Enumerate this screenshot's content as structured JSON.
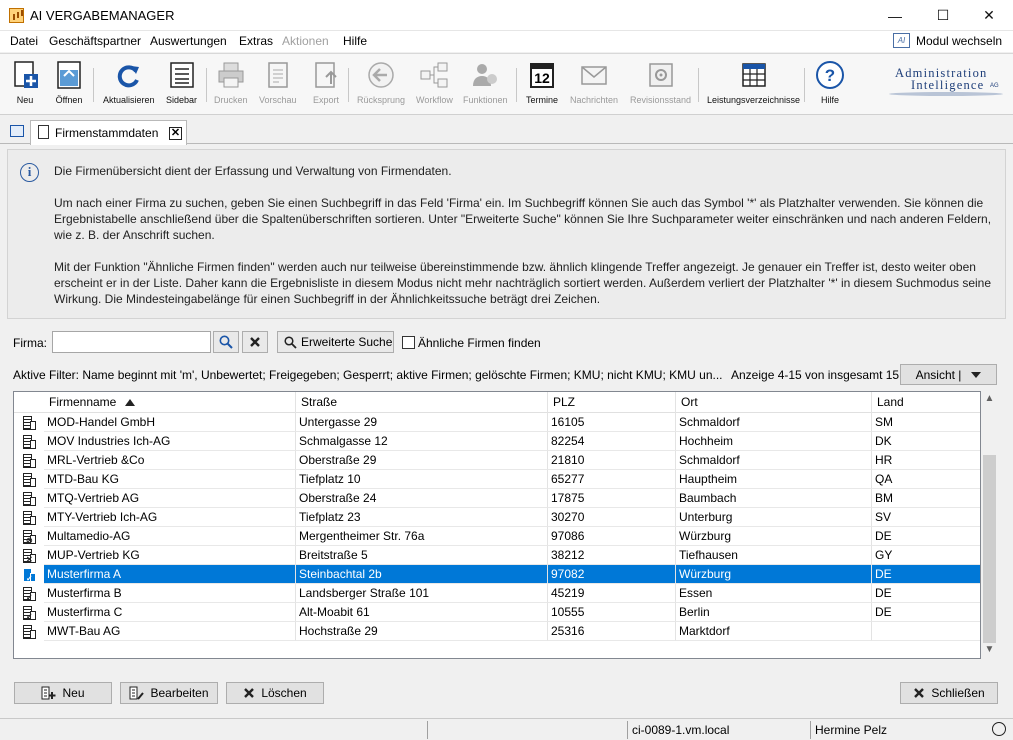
{
  "window": {
    "title": "AI VERGABEMANAGER",
    "minimize": "—",
    "maximize": "☐",
    "close": "✕"
  },
  "menu": {
    "items": [
      {
        "label": "Datei",
        "disabled": false
      },
      {
        "label": "Geschäftspartner",
        "disabled": false
      },
      {
        "label": "Auswertungen",
        "disabled": false
      },
      {
        "label": "Extras",
        "disabled": false
      },
      {
        "label": "Aktionen",
        "disabled": true
      },
      {
        "label": "Hilfe",
        "disabled": false
      }
    ],
    "modul_wechseln": "Modul wechseln",
    "modul_icon_text": "AI"
  },
  "toolbar": {
    "buttons": [
      {
        "label": "Neu",
        "icon": "new-document-icon",
        "disabled": false
      },
      {
        "label": "Öffnen",
        "icon": "open-icon",
        "disabled": false
      },
      {
        "label": "Aktualisieren",
        "icon": "refresh-icon",
        "disabled": false
      },
      {
        "label": "Sidebar",
        "icon": "sidebar-icon",
        "disabled": false
      },
      {
        "label": "Drucken",
        "icon": "print-icon",
        "disabled": true
      },
      {
        "label": "Vorschau",
        "icon": "preview-icon",
        "disabled": true
      },
      {
        "label": "Export",
        "icon": "export-icon",
        "disabled": true
      },
      {
        "label": "Rücksprung",
        "icon": "back-icon",
        "disabled": true
      },
      {
        "label": "Workflow",
        "icon": "workflow-icon",
        "disabled": true
      },
      {
        "label": "Funktionen",
        "icon": "functions-icon",
        "disabled": true
      },
      {
        "label": "Termine",
        "icon": "calendar-icon",
        "disabled": false
      },
      {
        "label": "Nachrichten",
        "icon": "mail-icon",
        "disabled": true
      },
      {
        "label": "Revisionsstand",
        "icon": "safe-icon",
        "disabled": true
      },
      {
        "label": "Leistungsverzeichnisse",
        "icon": "table-icon",
        "disabled": false
      },
      {
        "label": "Hilfe",
        "icon": "help-icon",
        "disabled": false
      }
    ],
    "calendar_day": "12",
    "brand_line1": "Administration",
    "brand_line2": "Intelligence",
    "brand_suffix": "AG"
  },
  "tab": {
    "label": "Firmenstammdaten",
    "close": "✕"
  },
  "info": {
    "p1": "Die Firmenübersicht dient der Erfassung und Verwaltung von Firmendaten.",
    "p2": "Um nach einer Firma zu suchen, geben Sie einen Suchbegriff in das Feld 'Firma' ein. Im Suchbegriff können Sie auch das Symbol '*' als Platzhalter verwenden. Sie können die Ergebnistabelle anschließend über die Spaltenüberschriften sortieren. Unter \"Erweiterte Suche\" können Sie Ihre Suchparameter weiter einschränken und nach anderen Feldern, wie z. B. der Anschrift suchen.",
    "p3": "Mit der Funktion \"Ähnliche Firmen finden\" werden auch nur teilweise übereinstimmende bzw. ähnlich klingende Treffer angezeigt. Je genauer ein Treffer ist, desto weiter oben erscheint er in der Liste. Daher kann die Ergebnisliste in diesem Modus nicht mehr nachträglich sortiert werden. Außerdem verliert der Platzhalter '*' in diesem Suchmodus seine Wirkung. Die Mindesteingabelänge für einen Suchbegriff in der Ähnlichkeitssuche beträgt drei Zeichen."
  },
  "search": {
    "firma_label": "Firma:",
    "firma_value": "",
    "erweiterte_suche": "Erweiterte Suche",
    "aehnliche_firmen": "Ähnliche Firmen finden",
    "aehnliche_checked": false
  },
  "filter": {
    "active_filter": "Aktive Filter: Name beginnt mit 'm',  Unbewertet; Freigegeben; Gesperrt; aktive Firmen; gelöschte Firmen; KMU; nicht KMU; KMU un...",
    "count": "Anzeige 4-15 von insgesamt 15",
    "ansicht": "Ansicht |"
  },
  "table": {
    "columns": [
      "Firmenname",
      "Straße",
      "PLZ",
      "Ort",
      "Land"
    ],
    "sort_column": "Firmenname",
    "sort_dir": "asc",
    "rows": [
      {
        "name": "MOD-Handel GmbH",
        "strasse": "Untergasse 29",
        "plz": "16105",
        "ort": "Schmaldorf",
        "land": "SM",
        "badge": "",
        "selected": false
      },
      {
        "name": "MOV Industries Ich-AG",
        "strasse": "Schmalgasse 12",
        "plz": "82254",
        "ort": "Hochheim",
        "land": "DK",
        "badge": "",
        "selected": false
      },
      {
        "name": "MRL-Vertrieb &Co",
        "strasse": "Oberstraße 29",
        "plz": "21810",
        "ort": "Schmaldorf",
        "land": "HR",
        "badge": "",
        "selected": false
      },
      {
        "name": "MTD-Bau KG",
        "strasse": "Tiefplatz 10",
        "plz": "65277",
        "ort": "Hauptheim",
        "land": "QA",
        "badge": "",
        "selected": false
      },
      {
        "name": "MTQ-Vertrieb AG",
        "strasse": "Oberstraße 24",
        "plz": "17875",
        "ort": "Baumbach",
        "land": "BM",
        "badge": "",
        "selected": false
      },
      {
        "name": "MTY-Vertrieb Ich-AG",
        "strasse": "Tiefplatz 23",
        "plz": "30270",
        "ort": "Unterburg",
        "land": "SV",
        "badge": "",
        "selected": false
      },
      {
        "name": "Multamedio-AG",
        "strasse": "Mergentheimer Str. 76a",
        "plz": "97086",
        "ort": "Würzburg",
        "land": "DE",
        "badge": "⊘",
        "selected": false
      },
      {
        "name": "MUP-Vertrieb KG",
        "strasse": "Breitstraße 5",
        "plz": "38212",
        "ort": "Tiefhausen",
        "land": "GY",
        "badge": "✕",
        "selected": false
      },
      {
        "name": "Musterfirma A",
        "strasse": "Steinbachtal 2b",
        "plz": "97082",
        "ort": "Würzburg",
        "land": "DE",
        "badge": "✓",
        "selected": true
      },
      {
        "name": "Musterfirma B",
        "strasse": "Landsberger Straße 101",
        "plz": "45219",
        "ort": "Essen",
        "land": "DE",
        "badge": "✓",
        "selected": false
      },
      {
        "name": "Musterfirma C",
        "strasse": "Alt-Moabit 61",
        "plz": "10555",
        "ort": "Berlin",
        "land": "DE",
        "badge": "✓",
        "selected": false
      },
      {
        "name": "MWT-Bau AG",
        "strasse": "Hochstraße 29",
        "plz": "25316",
        "ort": "Marktdorf",
        "land": "",
        "badge": "",
        "selected": false
      }
    ]
  },
  "buttons": {
    "neu": "Neu",
    "bearbeiten": "Bearbeiten",
    "loeschen": "Löschen",
    "schliessen": "Schließen"
  },
  "status": {
    "host": "ci-0089-1.vm.local",
    "user": "Hermine Pelz"
  },
  "colors": {
    "selection": "#0078d7",
    "brand": "#1f3f7a",
    "accent": "#2a5aa0"
  }
}
